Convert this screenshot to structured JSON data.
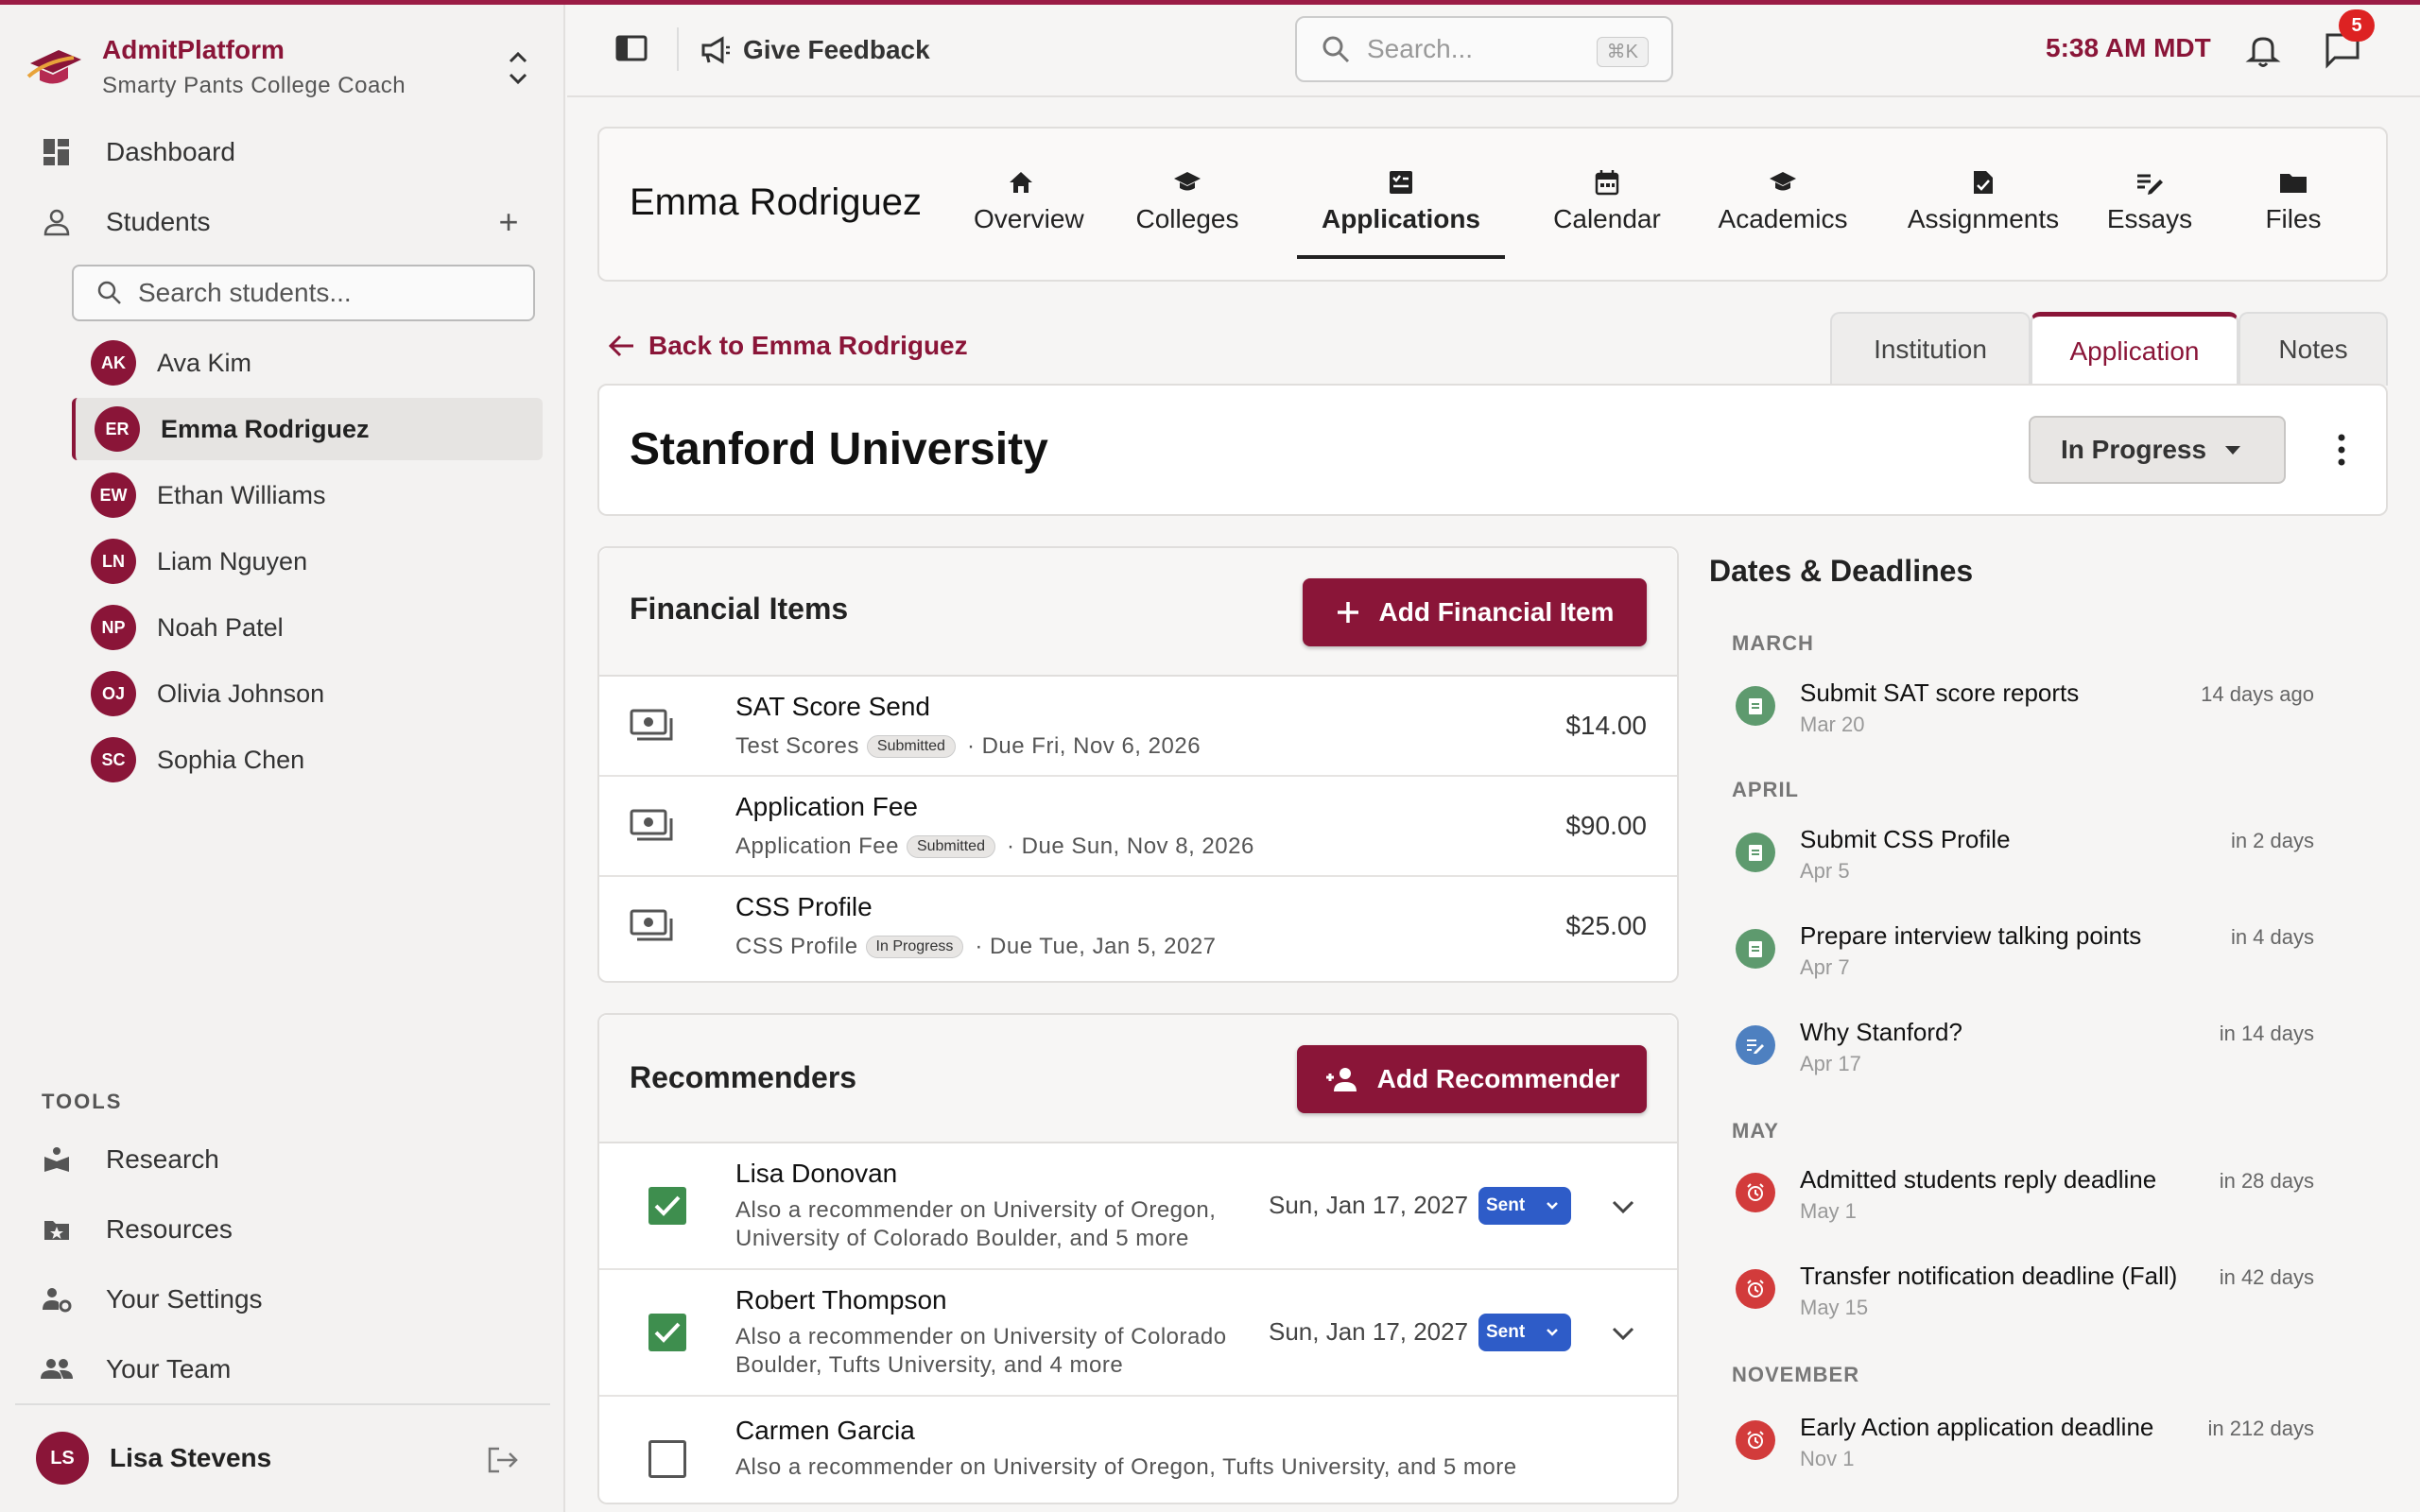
{
  "app": {
    "name": "AdmitPlatform",
    "org": "Smarty Pants College Coach"
  },
  "sidebar": {
    "dashboard": "Dashboard",
    "students": "Students",
    "search_placeholder": "Search students...",
    "student_list": [
      {
        "initials": "AK",
        "name": "Ava Kim"
      },
      {
        "initials": "ER",
        "name": "Emma Rodriguez"
      },
      {
        "initials": "EW",
        "name": "Ethan Williams"
      },
      {
        "initials": "LN",
        "name": "Liam Nguyen"
      },
      {
        "initials": "NP",
        "name": "Noah Patel"
      },
      {
        "initials": "OJ",
        "name": "Olivia Johnson"
      },
      {
        "initials": "SC",
        "name": "Sophia Chen"
      }
    ],
    "tools_heading": "TOOLS",
    "tools": [
      "Research",
      "Resources",
      "Your Settings",
      "Your Team"
    ],
    "user": {
      "initials": "LS",
      "name": "Lisa Stevens"
    }
  },
  "header": {
    "feedback": "Give Feedback",
    "search_placeholder": "Search...",
    "shortcut": "⌘K",
    "time": "5:38 AM MDT",
    "message_count": "5"
  },
  "student": {
    "name": "Emma Rodriguez",
    "tabs": [
      "Overview",
      "Colleges",
      "Applications",
      "Calendar",
      "Academics",
      "Assignments",
      "Essays",
      "Files"
    ],
    "active_tab": "Applications"
  },
  "back_link": "Back to Emma Rodriguez",
  "sub_tabs": [
    "Institution",
    "Application",
    "Notes"
  ],
  "institution": {
    "name": "Stanford University",
    "status": "In Progress"
  },
  "financial": {
    "title": "Financial Items",
    "add_label": "Add Financial Item",
    "items": [
      {
        "title": "SAT Score Send",
        "category": "Test Scores",
        "status": "Submitted",
        "due": "· Due Fri, Nov 6, 2026",
        "amount": "$14.00"
      },
      {
        "title": "Application Fee",
        "category": "Application Fee",
        "status": "Submitted",
        "due": "· Due Sun, Nov 8, 2026",
        "amount": "$90.00"
      },
      {
        "title": "CSS Profile",
        "category": "CSS Profile",
        "status": "In Progress",
        "due": "· Due Tue, Jan 5, 2027",
        "amount": "$25.00"
      }
    ]
  },
  "recommenders": {
    "title": "Recommenders",
    "add_label": "Add Recommender",
    "items": [
      {
        "name": "Lisa Donovan",
        "desc": "Also a recommender on University of Oregon, University of Colorado Boulder, and 5 more",
        "date": "Sun, Jan 17, 2027",
        "status": "Sent"
      },
      {
        "name": "Robert Thompson",
        "desc": "Also a recommender on University of Colorado Boulder, Tufts University, and 4 more",
        "date": "Sun, Jan 17, 2027",
        "status": "Sent"
      },
      {
        "name": "Carmen Garcia",
        "desc": "Also a recommender on University of Oregon, Tufts University, and 5 more"
      }
    ]
  },
  "deadlines": {
    "title": "Dates & Deadlines",
    "months": [
      "MARCH",
      "APRIL",
      "MAY",
      "NOVEMBER"
    ],
    "items": [
      {
        "title": "Submit SAT score reports",
        "date": "Mar 20",
        "relative": "14 days ago"
      },
      {
        "title": "Submit CSS Profile",
        "date": "Apr 5",
        "relative": "in 2 days"
      },
      {
        "title": "Prepare interview talking points",
        "date": "Apr 7",
        "relative": "in 4 days"
      },
      {
        "title": "Why Stanford?",
        "date": "Apr 17",
        "relative": "in 14 days"
      },
      {
        "title": "Admitted students reply deadline",
        "date": "May 1",
        "relative": "in 28 days"
      },
      {
        "title": "Transfer notification deadline (Fall)",
        "date": "May 15",
        "relative": "in 42 days"
      },
      {
        "title": "Early Action application deadline",
        "date": "Nov 1",
        "relative": "in 212 days"
      }
    ]
  },
  "colors": {
    "brand": "#8a1538",
    "sent": "#2e5cc8",
    "check": "#3e8e4e",
    "task": "#5e9a6e",
    "essay": "#4e80c0",
    "alarm": "#d23b3b"
  },
  "icons": [
    "home-icon",
    "graduation-cap-icon",
    "clipboard-icon",
    "calendar-icon",
    "book-icon",
    "file-icon",
    "essay-icon",
    "folder-icon",
    "money-icon",
    "bell-icon",
    "message-icon",
    "alarm-icon"
  ]
}
